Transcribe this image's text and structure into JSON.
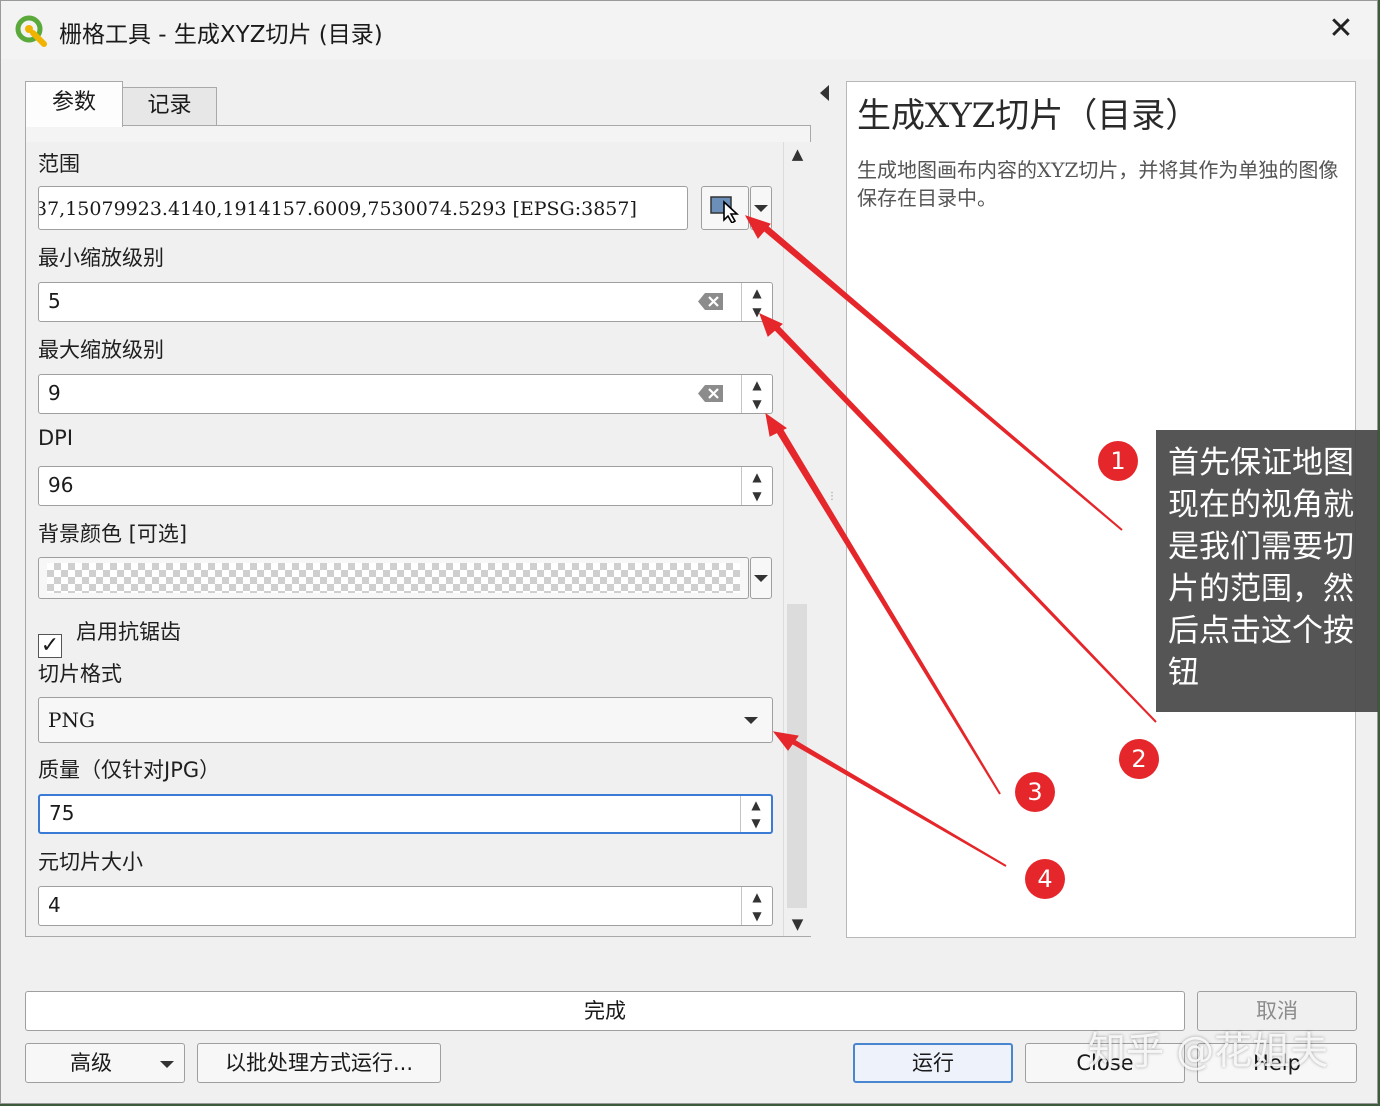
{
  "window": {
    "title": "栅格工具 - 生成XYZ切片 (目录)",
    "close_glyph": "✕"
  },
  "tabs": [
    {
      "label": "参数",
      "active": true
    },
    {
      "label": "记录",
      "active": false
    }
  ],
  "params": {
    "extent": {
      "label": "范围",
      "value": "37,15079923.4140,1914157.6009,7530074.5293 [EPSG:3857]"
    },
    "min_zoom": {
      "label": "最小缩放级别",
      "value": "5"
    },
    "max_zoom": {
      "label": "最大缩放级别",
      "value": "9"
    },
    "dpi": {
      "label": "DPI",
      "value": "96"
    },
    "background": {
      "label": "背景颜色 [可选]"
    },
    "antialias": {
      "label": "启用抗锯齿",
      "checked": true,
      "check_glyph": "✓"
    },
    "tile_format": {
      "label": "切片格式",
      "value": "PNG"
    },
    "quality": {
      "label": "质量（仅针对JPG）",
      "value": "75"
    },
    "metatile": {
      "label": "元切片大小",
      "value": "4"
    }
  },
  "help": {
    "title": "生成XYZ切片（目录）",
    "description": "生成地图画布内容的XYZ切片，并将其作为单独的图像保存在目录中。"
  },
  "footer": {
    "progress_text": "完成",
    "cancel": "取消",
    "advanced": "高级",
    "batch": "以批处理方式运行...",
    "run": "运行",
    "close": "Close",
    "help": "Help"
  },
  "annotation": {
    "callout_text": "首先保证地图现在的视角就是我们需要切片的范围，然后点击这个按钮",
    "markers": [
      "1",
      "2",
      "3",
      "4"
    ],
    "arrow_color": "#e5262a"
  },
  "watermark": "知乎 @花姐夫",
  "colors": {
    "focus_border": "#3a7bd5",
    "marker": "#e5262a",
    "qgis_green": "#5aa93a"
  }
}
